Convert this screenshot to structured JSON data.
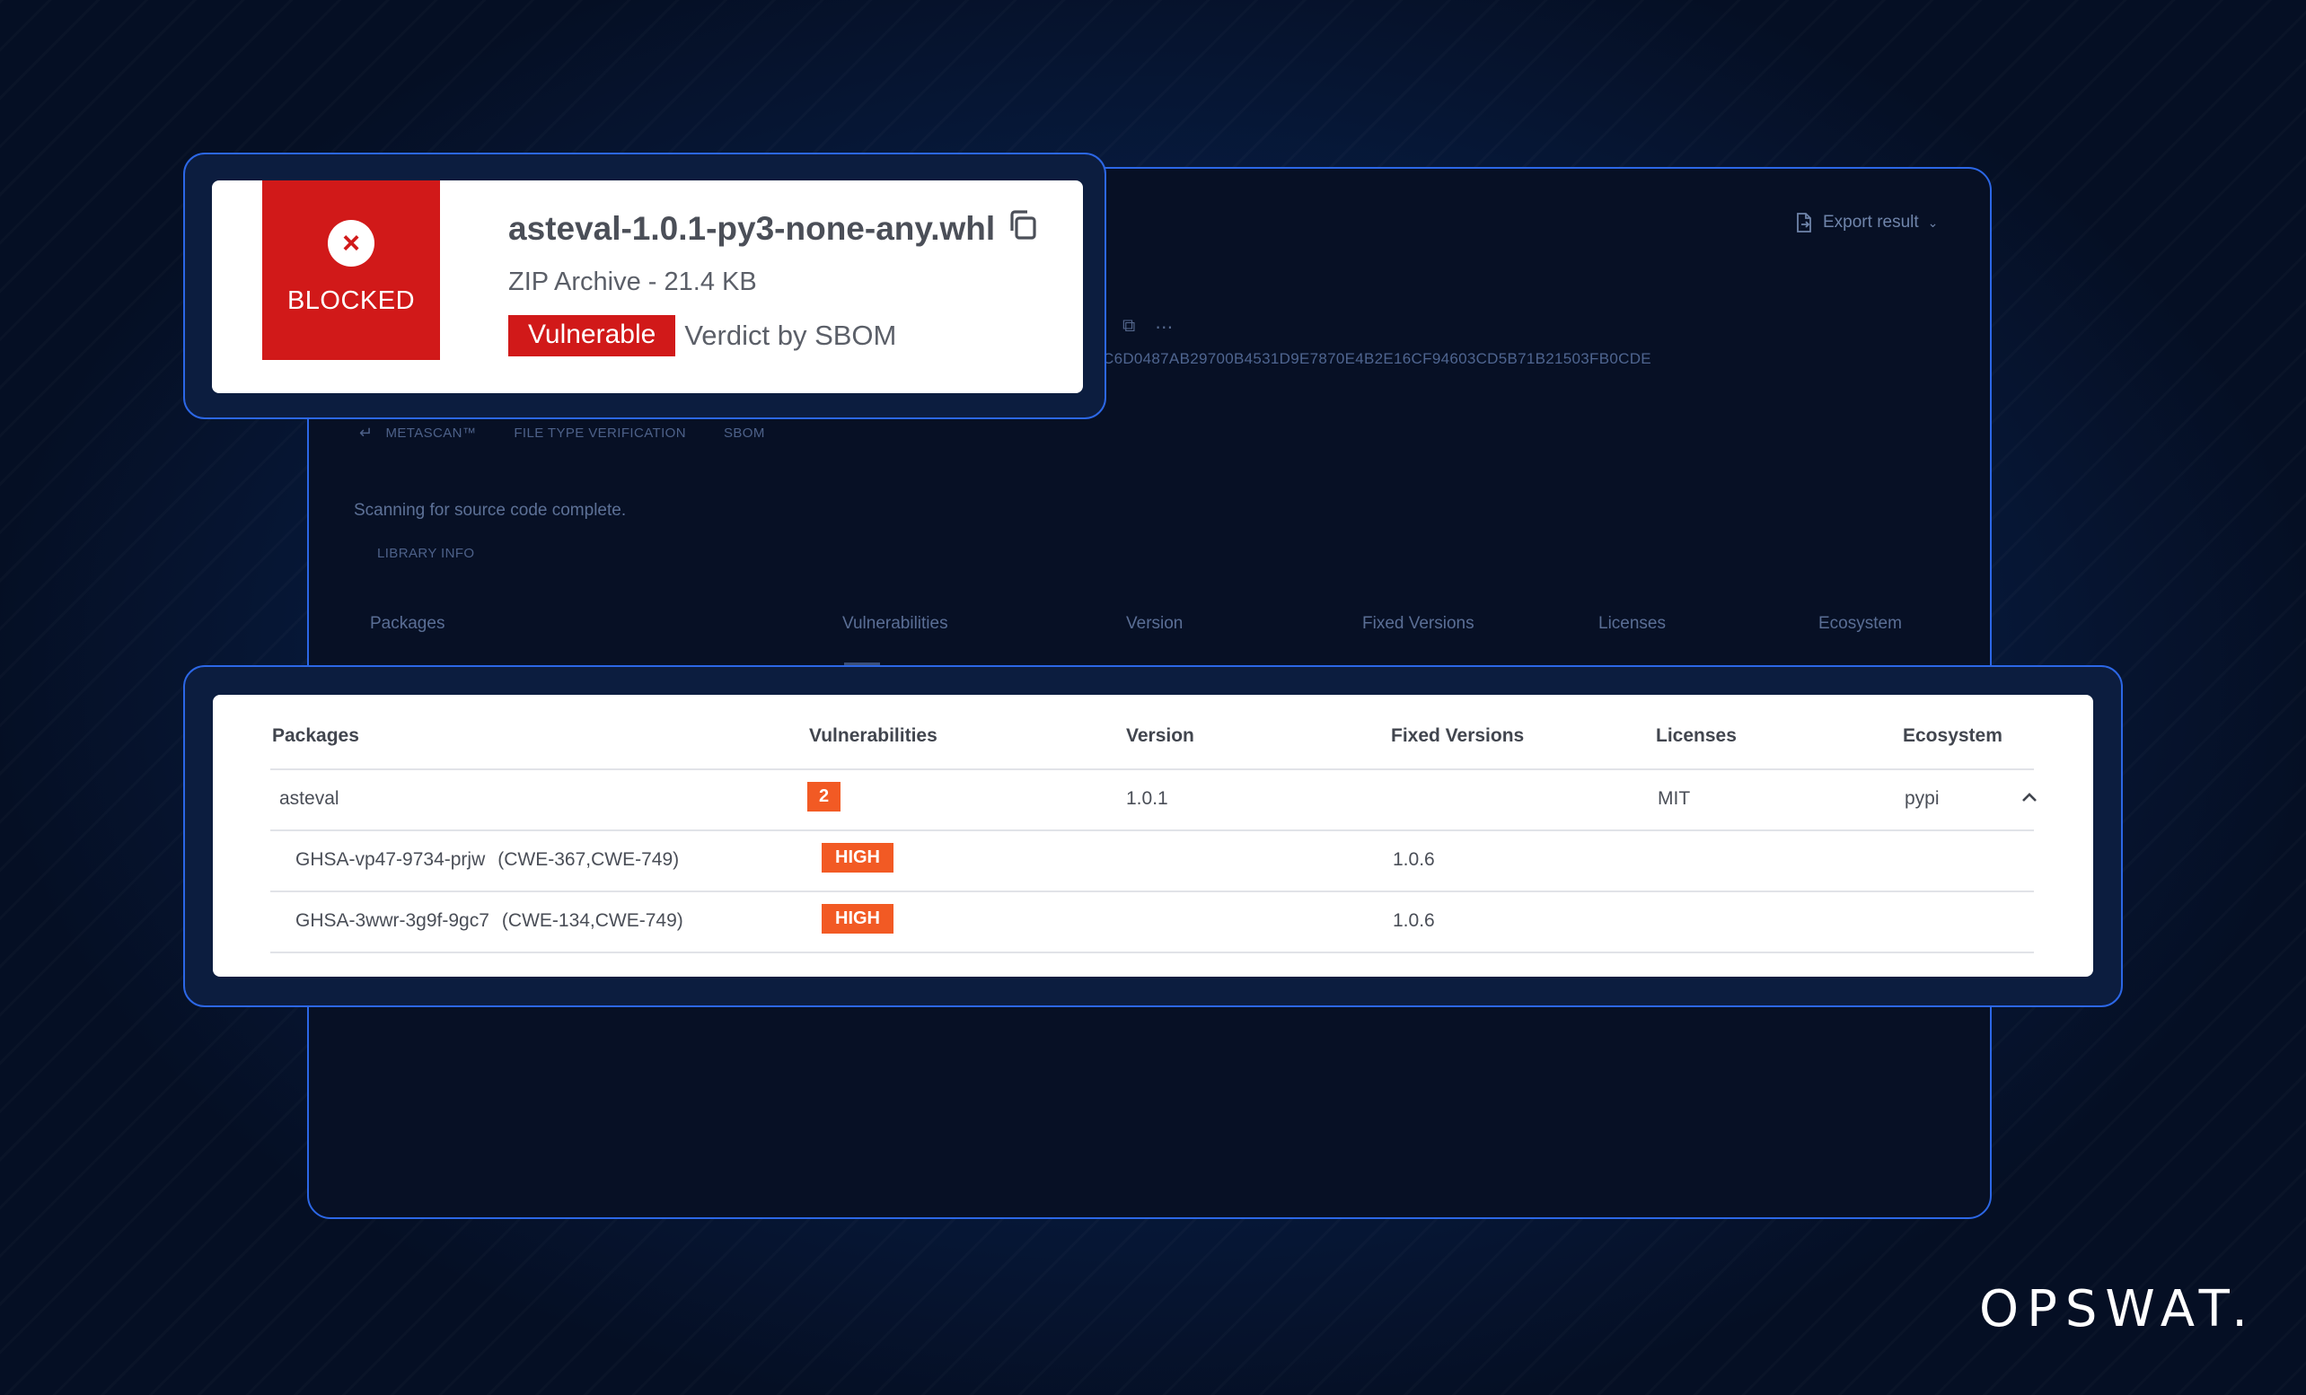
{
  "background_panel": {
    "export_label": "Export result",
    "hash": "C6D0487AB29700B4531D9E7870E4B2E16CF94603CD5B71B21503FB0CDE",
    "breadcrumbs": [
      "METASCAN™",
      "FILE TYPE VERIFICATION",
      "SBOM"
    ],
    "scan_status": "Scanning for source code complete.",
    "library_info": "LIBRARY INFO",
    "headers": [
      "Packages",
      "Vulnerabilities",
      "Version",
      "Fixed Versions",
      "Licenses",
      "Ecosystem"
    ]
  },
  "file_card": {
    "status": "BLOCKED",
    "file_name": "asteval-1.0.1-py3-none-any.whl",
    "file_meta": "ZIP Archive - 21.4 KB",
    "verdict_badge": "Vulnerable",
    "verdict_text": "Verdict by SBOM"
  },
  "table": {
    "headers": [
      "Packages",
      "Vulnerabilities",
      "Version",
      "Fixed Versions",
      "Licenses",
      "Ecosystem"
    ],
    "package": {
      "name": "asteval",
      "vuln_count": "2",
      "version": "1.0.1",
      "license": "MIT",
      "ecosystem": "pypi"
    },
    "vulnerabilities": [
      {
        "id": "GHSA-vp47-9734-prjw",
        "cwe": "(CWE-367,CWE-749)",
        "severity": "HIGH",
        "fixed": "1.0.6"
      },
      {
        "id": "GHSA-3wwr-3g9f-9gc7",
        "cwe": "(CWE-134,CWE-749)",
        "severity": "HIGH",
        "fixed": "1.0.6"
      }
    ]
  },
  "colors": {
    "blocked_red": "#d11919",
    "severity_orange": "#f25a24",
    "frame_blue": "#2c67e6"
  },
  "brand": "OPSWAT."
}
